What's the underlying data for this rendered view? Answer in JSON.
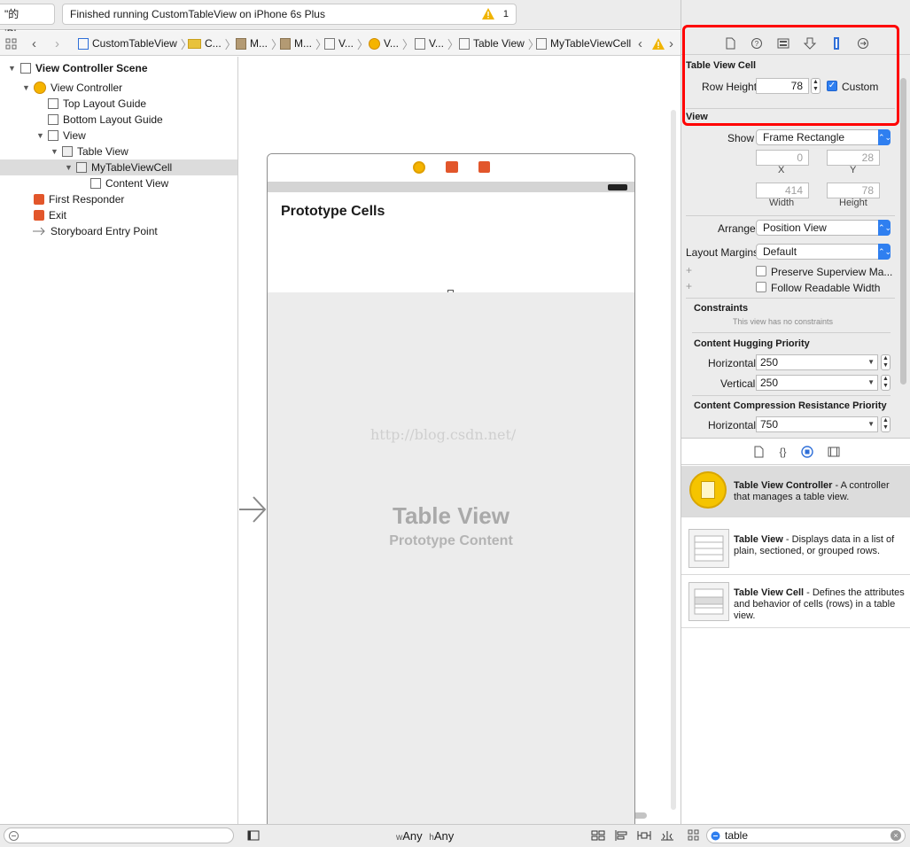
{
  "toolbar": {
    "device_label": "\"的 iPhone",
    "status_text": "Finished running CustomTableView on iPhone 6s Plus",
    "warning_count": "1"
  },
  "jumpbar": {
    "crumbs": [
      "CustomTableView",
      "C...",
      "M...",
      "M...",
      "V...",
      "V...",
      "V...",
      "Table View",
      "MyTableViewCell"
    ]
  },
  "outline": {
    "items": [
      {
        "label": "View Controller Scene"
      },
      {
        "label": "View Controller"
      },
      {
        "label": "Top Layout Guide"
      },
      {
        "label": "Bottom Layout Guide"
      },
      {
        "label": "View"
      },
      {
        "label": "Table View"
      },
      {
        "label": "MyTableViewCell"
      },
      {
        "label": "Content View"
      },
      {
        "label": "First Responder"
      },
      {
        "label": "Exit"
      },
      {
        "label": "Storyboard Entry Point"
      }
    ]
  },
  "canvas": {
    "prototype_cells": "Prototype Cells",
    "table_view_title": "Table View",
    "table_view_subtitle": "Prototype Content",
    "watermark": "http://blog.csdn.net/"
  },
  "inspector": {
    "section_cell": "Table View Cell",
    "row_height_label": "Row Height",
    "row_height_value": "78",
    "custom_label": "Custom",
    "custom_checked": true,
    "section_view": "View",
    "show_label": "Show",
    "show_value": "Frame Rectangle",
    "x_value": "0",
    "y_value": "28",
    "x_label": "X",
    "y_label": "Y",
    "width_value": "414",
    "height_value": "78",
    "width_label": "Width",
    "height_label": "Height",
    "arrange_label": "Arrange",
    "arrange_value": "Position View",
    "layout_margins_label": "Layout Margins",
    "layout_margins_value": "Default",
    "preserve_label": "Preserve Superview Ma...",
    "readable_label": "Follow Readable Width",
    "constraints_title": "Constraints",
    "constraints_note": "This view has no constraints",
    "hugging_title": "Content Hugging Priority",
    "horizontal_label": "Horizontal",
    "vertical_label": "Vertical",
    "hugging_h": "250",
    "hugging_v": "250",
    "compression_title": "Content Compression Resistance Priority",
    "compression_h": "750"
  },
  "library": {
    "items": [
      {
        "name": "Table View Controller",
        "desc": " - A controller that manages a table view."
      },
      {
        "name": "Table View",
        "desc": " - Displays data in a list of plain, sectioned, or grouped rows."
      },
      {
        "name": "Table View Cell",
        "desc": " - Defines the attributes and behavior of cells (rows) in a table view."
      }
    ]
  },
  "bottom": {
    "size_w_prefix": "w",
    "size_w_value": "Any",
    "size_h_prefix": "h",
    "size_h_value": "Any",
    "library_filter": "table"
  },
  "colors": {
    "highlight_border": "#ff0000",
    "accent": "#2f7ff0"
  }
}
